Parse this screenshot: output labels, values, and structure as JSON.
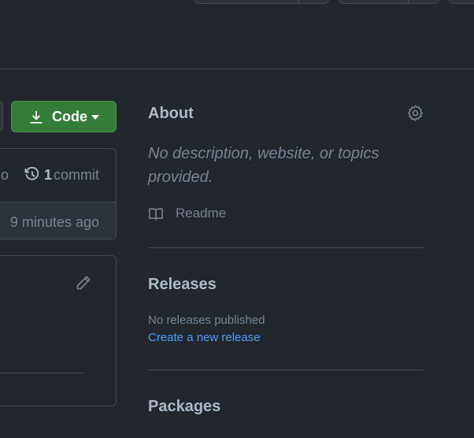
{
  "code_button": {
    "label": "Code"
  },
  "commit_bar": {
    "truncated_text": "o",
    "commit_count": "1",
    "commit_label": "commit",
    "last_updated": "9 minutes ago"
  },
  "sidebar": {
    "about": {
      "title": "About",
      "description": "No description, website, or topics provided.",
      "readme_label": "Readme"
    },
    "releases": {
      "title": "Releases",
      "empty_text": "No releases published",
      "create_link": "Create a new release"
    },
    "packages": {
      "title": "Packages"
    }
  },
  "colors": {
    "background": "#22272e",
    "border": "#444c56",
    "code_button": "#347d39",
    "link": "#539bf5",
    "muted_text": "#768390",
    "text": "#adbac7"
  },
  "icons": [
    "download-icon",
    "caret-down-icon",
    "history-icon",
    "pencil-icon",
    "gear-icon",
    "book-icon"
  ]
}
